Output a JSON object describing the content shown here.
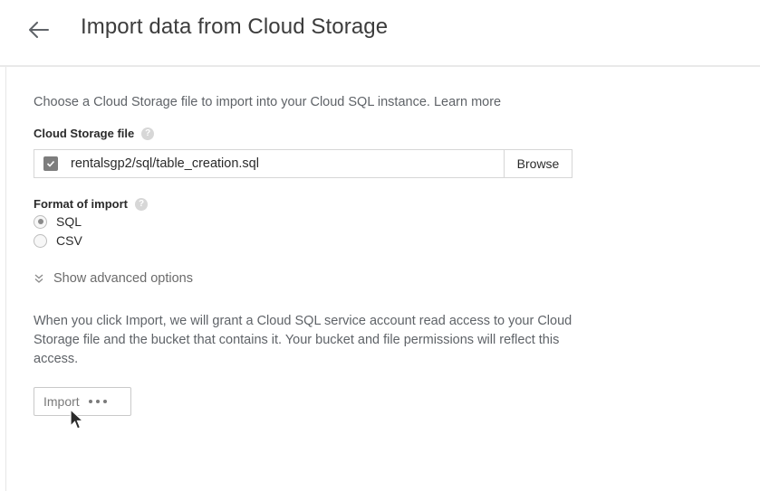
{
  "header": {
    "title": "Import data from Cloud Storage",
    "back_icon": "arrow-left-icon"
  },
  "intro": {
    "text": "Choose a Cloud Storage file to import into your Cloud SQL instance.",
    "link_label": "Learn more"
  },
  "file_field": {
    "label": "Cloud Storage file",
    "help_icon": "help-icon",
    "value": "rentalsgp2/sql/table_creation.sql",
    "browse_label": "Browse"
  },
  "format": {
    "label": "Format of import",
    "help_icon": "help-icon",
    "options": [
      {
        "label": "SQL",
        "selected": true
      },
      {
        "label": "CSV",
        "selected": false
      }
    ]
  },
  "advanced": {
    "label": "Show advanced options",
    "icon": "chevron-double-down-icon"
  },
  "notice": {
    "text": "When you click Import, we will grant a Cloud SQL service account read access to your Cloud Storage file and the bucket that contains it. Your bucket and file permissions will reflect this access."
  },
  "import_button": {
    "label": "Import",
    "state": "loading"
  }
}
